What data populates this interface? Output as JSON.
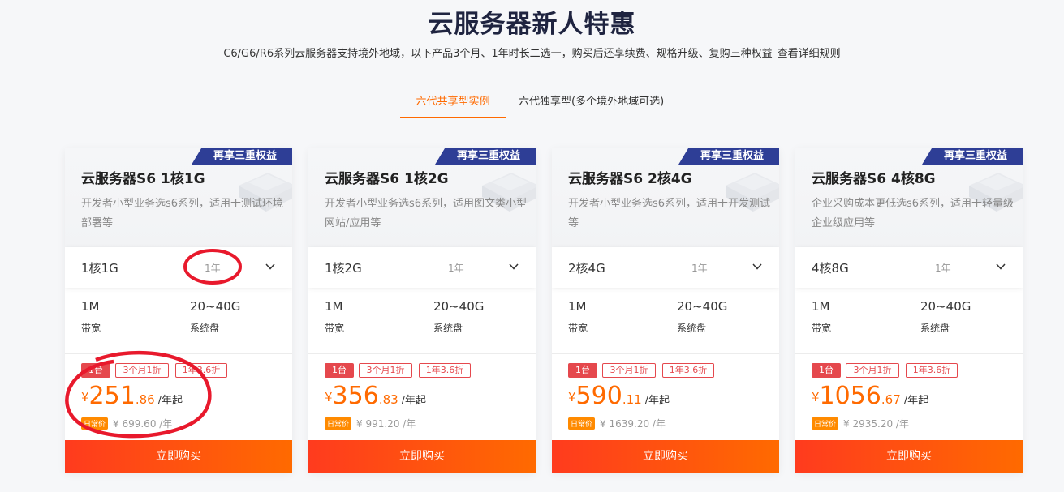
{
  "header": {
    "title": "云服务器新人特惠",
    "subtitle": "C6/G6/R6系列云服务器支持境外地域，以下产品3个月、1年时长二选一，购买后还享续费、规格升级、复购三种权益",
    "rules_link": "查看详细规则"
  },
  "tabs": [
    {
      "label": "六代共享型实例",
      "active": true
    },
    {
      "label": "六代独享型(多个境外地域可选)",
      "active": false
    }
  ],
  "cards": [
    {
      "badge": "再享三重权益",
      "title": "云服务器S6 1核1G",
      "desc": "开发者小型业务选s6系列，适用于测试环境部署等",
      "spec_select": "1核1G",
      "duration": "1年",
      "bandwidth_value": "1M",
      "bandwidth_label": "带宽",
      "disk_value": "20~40G",
      "disk_label": "系统盘",
      "chips": [
        "1台",
        "3个月1折",
        "1年3.6折"
      ],
      "currency": "¥",
      "price_int": "251",
      "price_dec": ".86",
      "price_unit": "/年起",
      "orig_tag": "日常价",
      "orig_price": "¥ 699.60 /年",
      "buy": "立即购买"
    },
    {
      "badge": "再享三重权益",
      "title": "云服务器S6 1核2G",
      "desc": "开发者小型业务选s6系列，适用图文类小型网站/应用等",
      "spec_select": "1核2G",
      "duration": "1年",
      "bandwidth_value": "1M",
      "bandwidth_label": "带宽",
      "disk_value": "20~40G",
      "disk_label": "系统盘",
      "chips": [
        "1台",
        "3个月1折",
        "1年3.6折"
      ],
      "currency": "¥",
      "price_int": "356",
      "price_dec": ".83",
      "price_unit": "/年起",
      "orig_tag": "日常价",
      "orig_price": "¥ 991.20 /年",
      "buy": "立即购买"
    },
    {
      "badge": "再享三重权益",
      "title": "云服务器S6 2核4G",
      "desc": "开发者小型业务选s6系列，适用于开发测试等",
      "spec_select": "2核4G",
      "duration": "1年",
      "bandwidth_value": "1M",
      "bandwidth_label": "带宽",
      "disk_value": "20~40G",
      "disk_label": "系统盘",
      "chips": [
        "1台",
        "3个月1折",
        "1年3.6折"
      ],
      "currency": "¥",
      "price_int": "590",
      "price_dec": ".11",
      "price_unit": "/年起",
      "orig_tag": "日常价",
      "orig_price": "¥ 1639.20 /年",
      "buy": "立即购买"
    },
    {
      "badge": "再享三重权益",
      "title": "云服务器S6 4核8G",
      "desc": "企业采购成本更低选s6系列，适用于轻量级企业级应用等",
      "spec_select": "4核8G",
      "duration": "1年",
      "bandwidth_value": "1M",
      "bandwidth_label": "带宽",
      "disk_value": "20~40G",
      "disk_label": "系统盘",
      "chips": [
        "1台",
        "3个月1折",
        "1年3.6折"
      ],
      "currency": "¥",
      "price_int": "1056",
      "price_dec": ".67",
      "price_unit": "/年起",
      "orig_tag": "日常价",
      "orig_price": "¥ 2935.20 /年",
      "buy": "立即购买"
    }
  ],
  "colors": {
    "accent": "#ff6a00",
    "badge": "#2e3e96",
    "chip_red": "#e5484d",
    "annotation_red": "#e8192c"
  },
  "icons": {
    "chevron": "chevron-down-icon",
    "decoration": "server-illustration-icon"
  }
}
